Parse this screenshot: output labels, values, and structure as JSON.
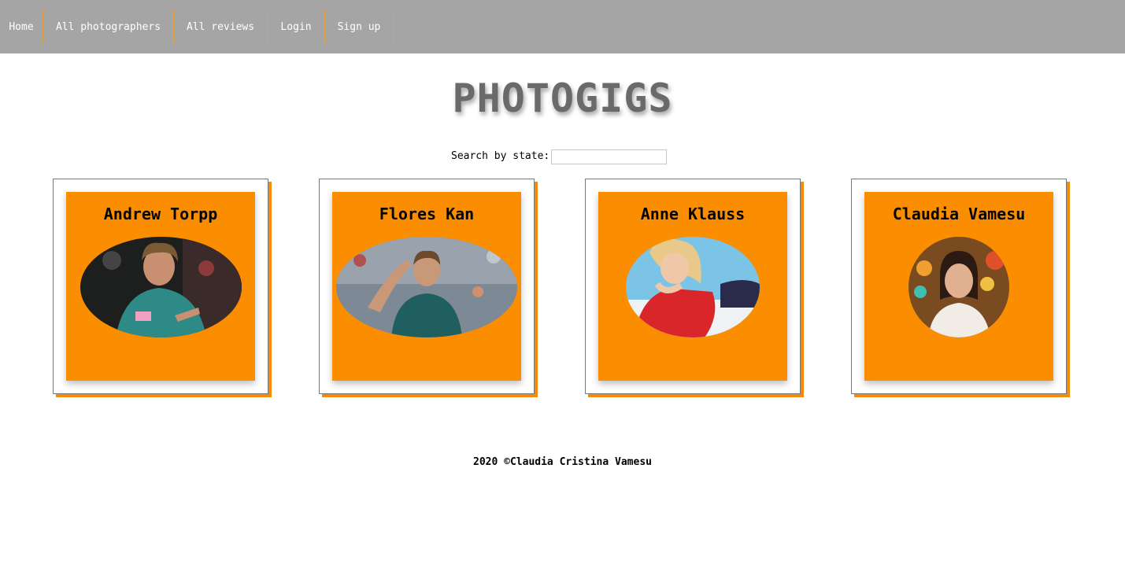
{
  "nav": {
    "items": [
      {
        "label": "Home"
      },
      {
        "label": "All photographers"
      },
      {
        "label": "All reviews"
      },
      {
        "label": "Login"
      },
      {
        "label": "Sign up"
      }
    ]
  },
  "header": {
    "title": "PHOTOGIGS"
  },
  "search": {
    "label": "Search by state:",
    "value": "",
    "placeholder": ""
  },
  "photographers": [
    {
      "name": "Andrew Torpp",
      "photo_icon": "man-tennis-photo-icon"
    },
    {
      "name": "Flores Kan",
      "photo_icon": "woman-tennis-photo-icon"
    },
    {
      "name": "Anne Klauss",
      "photo_icon": "woman-lying-photo-icon"
    },
    {
      "name": "Claudia Vamesu",
      "photo_icon": "woman-portrait-photo-icon"
    }
  ],
  "footer": {
    "text": "2020 ©Claudia Cristina Vamesu"
  },
  "colors": {
    "navbar": "#a5a5a5",
    "card_orange": "#fb8d00",
    "title_gray": "#6a6a6a"
  }
}
